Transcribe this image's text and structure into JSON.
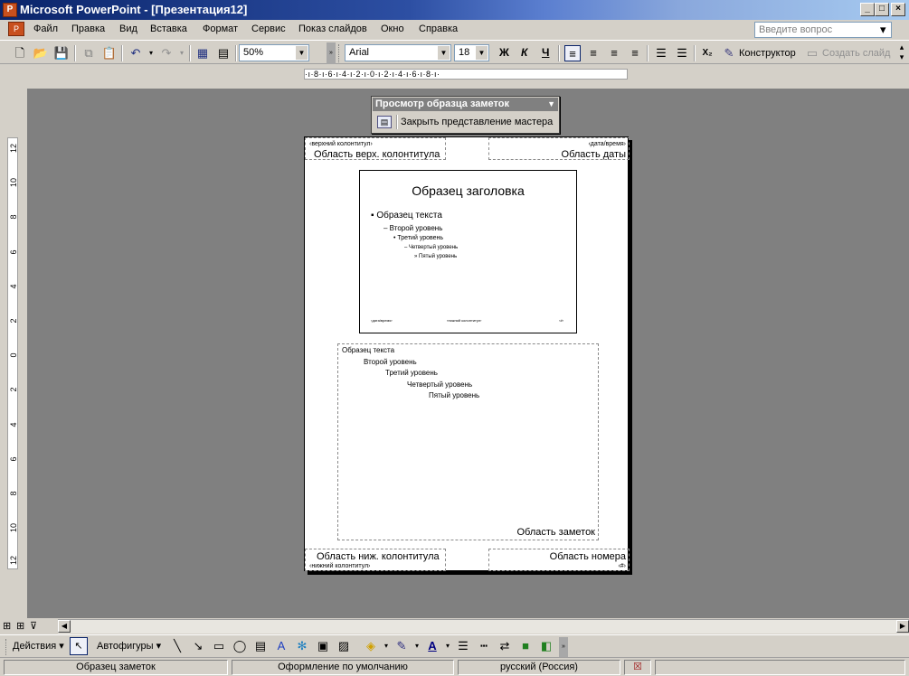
{
  "window": {
    "title": "Microsoft PowerPoint - [Презентация12]"
  },
  "menu": {
    "items": [
      "Файл",
      "Правка",
      "Вид",
      "Вставка",
      "Формат",
      "Сервис",
      "Показ слайдов",
      "Окно",
      "Справка"
    ],
    "help_placeholder": "Введите вопрос"
  },
  "toolbar": {
    "zoom": "50%",
    "font": "Arial",
    "font_size": "18",
    "bold": "Ж",
    "italic": "К",
    "underline": "Ч",
    "designer": "Конструктор",
    "new_slide": "Создать слайд"
  },
  "ruler_top": "·ı·8·ı·6·ı·4·ı·2·ı·0·ı·2·ı·4·ı·6·ı·8·ı·",
  "ruler_left": [
    "12",
    "10",
    "8",
    "6",
    "4",
    "2",
    "0",
    "2",
    "4",
    "6",
    "8",
    "10",
    "12"
  ],
  "floating_toolbar": {
    "caption": "Просмотр образца заметок",
    "close_master": "Закрыть представление мастера"
  },
  "notes_page": {
    "header_small": "‹верхний колонтитул›",
    "header_label": "Область верх. колонтитула",
    "date_small": "‹дата/время›",
    "date_label": "Область даты",
    "slide": {
      "title": "Образец заголовка",
      "l1": "Образец текста",
      "l2": "Второй уровень",
      "l3": "Третий уровень",
      "l4": "Четвертый уровень",
      "l5": "Пятый уровень",
      "footer_date": "‹дата/время›",
      "footer_center": "‹нижний колонтитул›",
      "footer_num": "‹#›"
    },
    "notes": {
      "l1": "Образец текста",
      "l2": "Второй уровень",
      "l3": "Третий уровень",
      "l4": "Четвертый уровень",
      "l5": "Пятый уровень",
      "label": "Область заметок"
    },
    "footer_label": "Область ниж. колонтитула",
    "footer_small": "‹нижний колонтитул›",
    "number_label": "Область номера",
    "number_small": "‹#›"
  },
  "drawing_toolbar": {
    "actions": "Действия",
    "autoshapes": "Автофигуры"
  },
  "status": {
    "view": "Образец заметок",
    "design": "Оформление по умолчанию",
    "language": "русский (Россия)"
  }
}
